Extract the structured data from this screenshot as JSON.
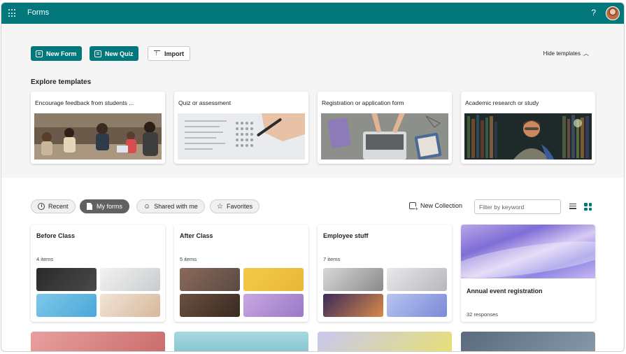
{
  "app": {
    "title": "Forms",
    "help_label": "?"
  },
  "toolbar": {
    "new_form_label": "New Form",
    "new_quiz_label": "New Quiz",
    "import_label": "Import",
    "hide_templates_label": "Hide templates"
  },
  "templates": {
    "section_title": "Explore templates",
    "items": [
      {
        "title": "Encourage feedback from students ..."
      },
      {
        "title": "Quiz or assessment"
      },
      {
        "title": "Registration or application form"
      },
      {
        "title": "Academic research or study"
      }
    ]
  },
  "filters": {
    "tabs": [
      {
        "label": "Recent"
      },
      {
        "label": "My forms",
        "selected": true
      },
      {
        "label": "Shared with me"
      },
      {
        "label": "Favorites"
      }
    ],
    "new_collection_label": "New Collection",
    "search_placeholder": "Filter by keyword"
  },
  "collections": [
    {
      "title": "Before Class",
      "count": "4 items"
    },
    {
      "title": "After Class",
      "count": "5 items"
    },
    {
      "title": "Employee stuff",
      "count": "7 items"
    }
  ],
  "forms": [
    {
      "title": "Annual event registration",
      "responses": "32 responses"
    }
  ],
  "colors": {
    "brand": "#03787c",
    "selected_tab": "#616161"
  }
}
